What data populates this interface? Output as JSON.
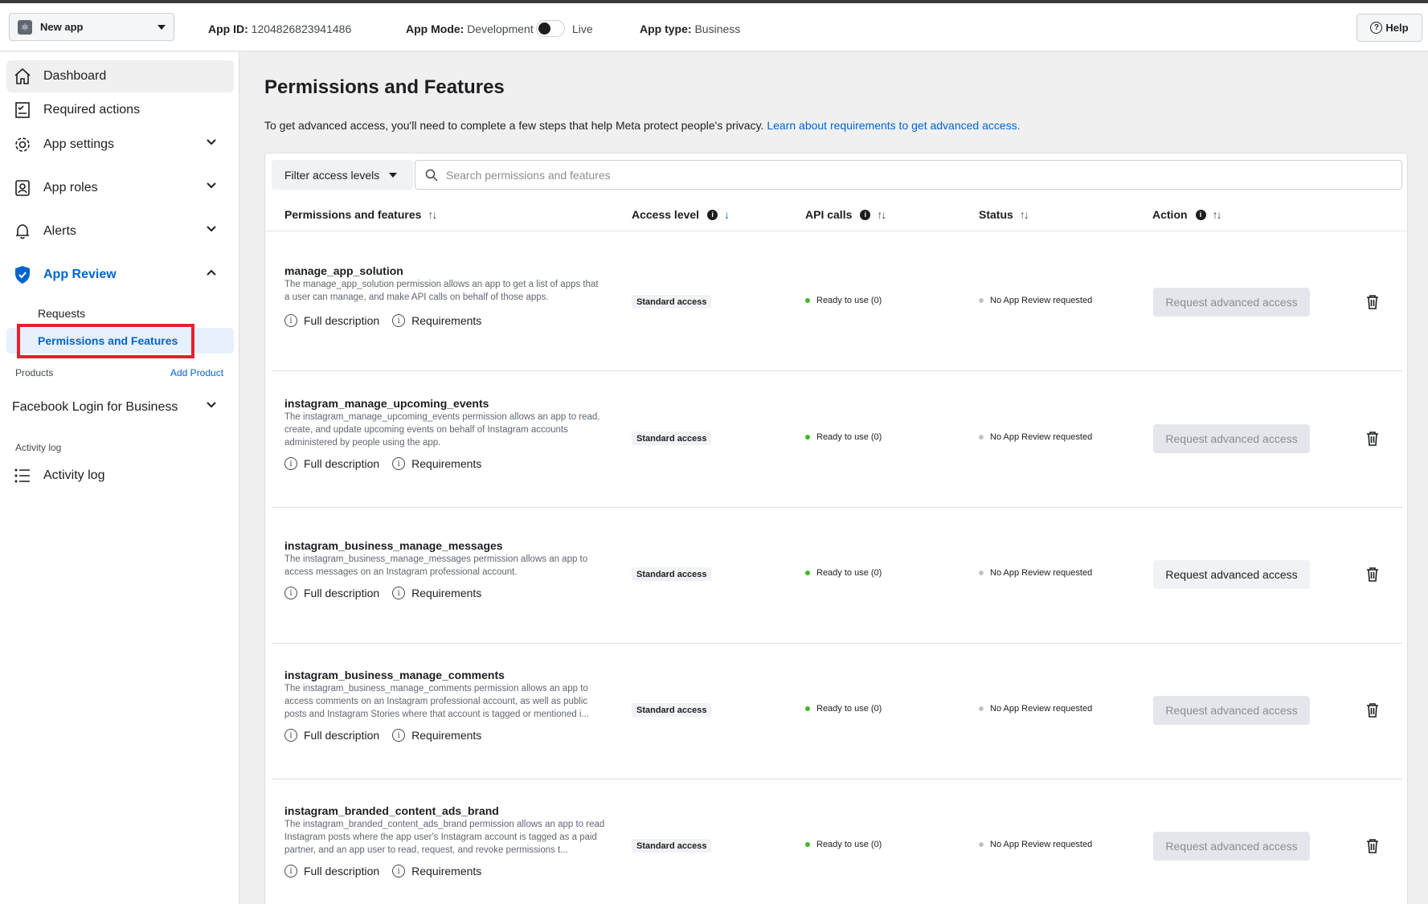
{
  "topbar": {
    "app_name": "New app",
    "app_id_label": "App ID:",
    "app_id": "1204826823941486",
    "app_mode_label": "App Mode:",
    "app_mode": "Development",
    "app_mode_alt": "Live",
    "app_type_label": "App type:",
    "app_type": "Business",
    "help_label": "Help"
  },
  "sidebar": {
    "dashboard": "Dashboard",
    "required_actions": "Required actions",
    "app_settings": "App settings",
    "app_roles": "App roles",
    "alerts": "Alerts",
    "app_review": "App Review",
    "requests": "Requests",
    "permissions_features": "Permissions and Features",
    "products_label": "Products",
    "add_product": "Add Product",
    "facebook_login": "Facebook Login for Business",
    "activity_log_section": "Activity log",
    "activity_log": "Activity log"
  },
  "main": {
    "title": "Permissions and Features",
    "intro_text": "To get advanced access, you'll need to complete a few steps that help Meta protect people's privacy.",
    "intro_link": "Learn about requirements to get advanced access.",
    "filter_label": "Filter access levels",
    "search_placeholder": "Search permissions and features",
    "columns": {
      "permissions": "Permissions and features",
      "access_level": "Access level",
      "api_calls": "API calls",
      "status": "Status",
      "action": "Action"
    },
    "rows": [
      {
        "name": "manage_app_solution",
        "description": "The manage_app_solution permission allows an app to get a list of apps that a user can manage, and make API calls on behalf of those apps.",
        "full_description": "Full description",
        "requirements": "Requirements",
        "access": "Standard access",
        "api": "Ready to use (0)",
        "status": "No App Review requested",
        "action": "Request advanced access",
        "action_enabled": false
      },
      {
        "name": "instagram_manage_upcoming_events",
        "description": "The instagram_manage_upcoming_events permission allows an app to read, create, and update upcoming events on behalf of Instagram accounts administered by people using the app.",
        "full_description": "Full description",
        "requirements": "Requirements",
        "access": "Standard access",
        "api": "Ready to use (0)",
        "status": "No App Review requested",
        "action": "Request advanced access",
        "action_enabled": false
      },
      {
        "name": "instagram_business_manage_messages",
        "description": "The instagram_business_manage_messages permission allows an app to access messages on an Instagram professional account.",
        "full_description": "Full description",
        "requirements": "Requirements",
        "access": "Standard access",
        "api": "Ready to use (0)",
        "status": "No App Review requested",
        "action": "Request advanced access",
        "action_enabled": true
      },
      {
        "name": "instagram_business_manage_comments",
        "description": "The instagram_business_manage_comments permission allows an app to access comments on an Instagram professional account, as well as public posts and Instagram Stories where that account is tagged or mentioned i...",
        "full_description": "Full description",
        "requirements": "Requirements",
        "access": "Standard access",
        "api": "Ready to use (0)",
        "status": "No App Review requested",
        "action": "Request advanced access",
        "action_enabled": false
      },
      {
        "name": "instagram_branded_content_ads_brand",
        "description": "The instagram_branded_content_ads_brand permission allows an app to read Instagram posts where the app user's Instagram account is tagged as a paid partner, and an app user to read, request, and revoke permissions t...",
        "full_description": "Full description",
        "requirements": "Requirements",
        "access": "Standard access",
        "api": "Ready to use (0)",
        "status": "No App Review requested",
        "action": "Request advanced access",
        "action_enabled": false
      }
    ]
  }
}
